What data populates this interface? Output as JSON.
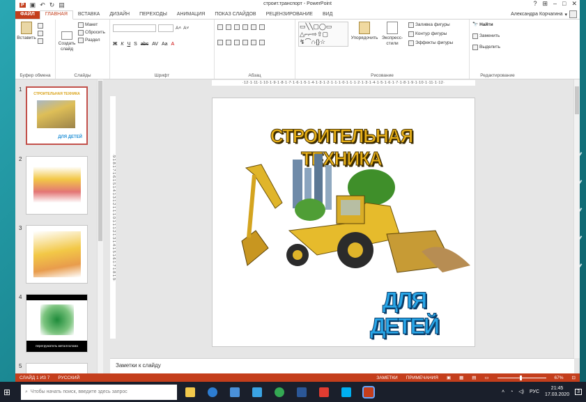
{
  "window": {
    "title": "строит.транспорт - PowerPoint",
    "controls": [
      "?",
      "⊞",
      "–",
      "□",
      "✕"
    ],
    "user_name": "Александра Корчагина"
  },
  "tabs": [
    "ФАЙЛ",
    "ГЛАВНАЯ",
    "ВСТАВКА",
    "ДИЗАЙН",
    "ПЕРЕХОДЫ",
    "АНИМАЦИЯ",
    "ПОКАЗ СЛАЙДОВ",
    "РЕЦЕНЗИРОВАНИЕ",
    "ВИД"
  ],
  "ribbon": {
    "clipboard": {
      "label": "Буфер обмена",
      "paste": "Вставить"
    },
    "slides": {
      "label": "Слайды",
      "new_slide": "Создать слайд",
      "layout": "Макет",
      "reset": "Сбросить",
      "section": "Раздел"
    },
    "font": {
      "label": "Шрифт",
      "bold": "Ж",
      "italic": "К",
      "underline": "Ч",
      "shadow": "S",
      "strike": "abc",
      "spacing": "AV",
      "case": "Aa",
      "color": "A",
      "grow": "A˄",
      "shrink": "A˅"
    },
    "paragraph": {
      "label": "Абзац"
    },
    "drawing": {
      "label": "Рисование",
      "arrange": "Упорядочить",
      "quick_styles": "Экспресс-стили",
      "fill": "Заливка фигуры",
      "outline": "Контур фигуры",
      "effects": "Эффекты фигуры"
    },
    "editing": {
      "label": "Редактирование",
      "find": "Найти",
      "replace": "Заменить",
      "select": "Выделить"
    }
  },
  "slide_thumbnails": [
    {
      "number": "1",
      "caption_top": "СТРОИТЕЛЬНАЯ ТЕХНИКА",
      "caption_bottom": "ДЛЯ ДЕТЕЙ",
      "selected": true
    },
    {
      "number": "2",
      "caption_top": "",
      "caption_bottom": "",
      "selected": false
    },
    {
      "number": "3",
      "caption_top": "",
      "caption_bottom": "",
      "selected": false
    },
    {
      "number": "4",
      "caption_top": "",
      "caption_bottom": "перегружатель металлолома",
      "selected": false
    },
    {
      "number": "5",
      "caption_top": "",
      "caption_bottom": "",
      "selected": false
    }
  ],
  "ruler_h": "·12·1·11·1·10·1·9·1·8·1·7·1·6·1·5·1·4·1·3·1·2·1·1·1·0·1·1·1·2·1·3·1·4·1·5·1·6·1·7·1·8·1·9·1·10·1·11·1·12·",
  "ruler_v": "·9·1·8·1·7·1·6·1·5·1·4·1·3·1·2·1·1·1·0·1·1·1·2·1·3·1·4·1·5·1·6·1·7·1·8·1·9·",
  "slide": {
    "title": "СТРОИТЕЛЬНАЯ ТЕХНИКА",
    "subtitle": "ДЛЯ ДЕТЕЙ"
  },
  "notes_placeholder": "Заметки к слайду",
  "statusbar": {
    "slide_counter": "СЛАЙД 1 ИЗ 7",
    "language": "РУССКИЙ",
    "notes": "ЗАМЕТКИ",
    "comments": "ПРИМЕЧАНИЯ",
    "zoom": "67%"
  },
  "taskbar": {
    "search_placeholder": "Чтобы начать поиск, введите здесь запрос",
    "lang": "РУС",
    "time": "21:45",
    "date": "17.03.2020",
    "notification_count": "3"
  },
  "colors": {
    "accent": "#c43e1c",
    "title_yellow": "#e8b018",
    "subtitle_blue": "#28a6e8"
  }
}
